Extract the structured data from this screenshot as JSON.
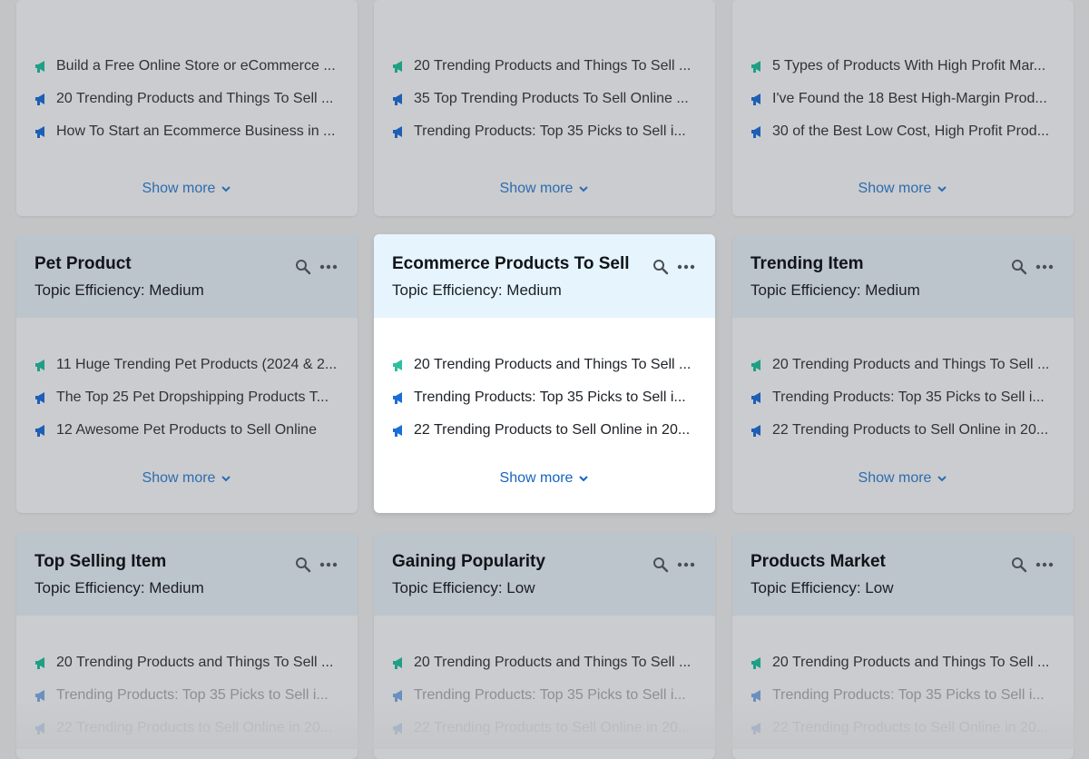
{
  "colors": {
    "accent_link": "#2c6cb0",
    "organic_icon": "#1f9f86",
    "paid_icon": "#1d5fb5",
    "overlay": "#c3c4c6"
  },
  "icons": {
    "search": "search-icon",
    "more": "more-dots-icon",
    "megaphone": "megaphone-icon",
    "chevron": "chevron-down-icon"
  },
  "cards": [
    {
      "title": "",
      "subtitle": "",
      "links": [
        {
          "text": "Build a Free Online Store or eCommerce ...",
          "kind": "organic"
        },
        {
          "text": "20 Trending Products and Things To Sell ...",
          "kind": "paid"
        },
        {
          "text": "How To Start an Ecommerce Business in ...",
          "kind": "paid"
        }
      ],
      "show_more": "Show more"
    },
    {
      "title": "",
      "subtitle": "",
      "links": [
        {
          "text": "20 Trending Products and Things To Sell ...",
          "kind": "organic"
        },
        {
          "text": "35 Top Trending Products To Sell Online ...",
          "kind": "paid"
        },
        {
          "text": "Trending Products: Top 35 Picks to Sell i...",
          "kind": "paid"
        }
      ],
      "show_more": "Show more"
    },
    {
      "title": "",
      "subtitle": "",
      "links": [
        {
          "text": "5 Types of Products With High Profit Mar...",
          "kind": "organic"
        },
        {
          "text": "I've Found the 18 Best High-Margin Prod...",
          "kind": "paid"
        },
        {
          "text": "30 of the Best Low Cost, High Profit Prod...",
          "kind": "paid"
        }
      ],
      "show_more": "Show more"
    },
    {
      "title": "Pet Product",
      "subtitle": "Topic Efficiency: Medium",
      "links": [
        {
          "text": "11 Huge Trending Pet Products (2024 & 2...",
          "kind": "organic"
        },
        {
          "text": "The Top 25 Pet Dropshipping Products T...",
          "kind": "paid"
        },
        {
          "text": "12 Awesome Pet Products to Sell Online",
          "kind": "paid"
        }
      ],
      "show_more": "Show more"
    },
    {
      "title": "Ecommerce Products To Sell",
      "subtitle": "Topic Efficiency: Medium",
      "links": [
        {
          "text": "20 Trending Products and Things To Sell ...",
          "kind": "organic"
        },
        {
          "text": "Trending Products: Top 35 Picks to Sell i...",
          "kind": "paid"
        },
        {
          "text": "22 Trending Products to Sell Online in 20...",
          "kind": "paid"
        }
      ],
      "show_more": "Show more"
    },
    {
      "title": "Trending Item",
      "subtitle": "Topic Efficiency: Medium",
      "links": [
        {
          "text": "20 Trending Products and Things To Sell ...",
          "kind": "organic"
        },
        {
          "text": "Trending Products: Top 35 Picks to Sell i...",
          "kind": "paid"
        },
        {
          "text": "22 Trending Products to Sell Online in 20...",
          "kind": "paid"
        }
      ],
      "show_more": "Show more"
    },
    {
      "title": "Top Selling Item",
      "subtitle": "Topic Efficiency: Medium",
      "links": [
        {
          "text": "20 Trending Products and Things To Sell ...",
          "kind": "organic"
        },
        {
          "text": "Trending Products: Top 35 Picks to Sell i...",
          "kind": "paid"
        },
        {
          "text": "22 Trending Products to Sell Online in 20...",
          "kind": "paid"
        }
      ],
      "show_more": ""
    },
    {
      "title": "Gaining Popularity",
      "subtitle": "Topic Efficiency: Low",
      "links": [
        {
          "text": "20 Trending Products and Things To Sell ...",
          "kind": "organic"
        },
        {
          "text": "Trending Products: Top 35 Picks to Sell i...",
          "kind": "paid"
        },
        {
          "text": "22 Trending Products to Sell Online in 20...",
          "kind": "paid"
        }
      ],
      "show_more": ""
    },
    {
      "title": "Products Market",
      "subtitle": "Topic Efficiency: Low",
      "links": [
        {
          "text": "20 Trending Products and Things To Sell ...",
          "kind": "organic"
        },
        {
          "text": "Trending Products: Top 35 Picks to Sell i...",
          "kind": "paid"
        },
        {
          "text": "22 Trending Products to Sell Online in 20...",
          "kind": "paid"
        }
      ],
      "show_more": ""
    }
  ]
}
